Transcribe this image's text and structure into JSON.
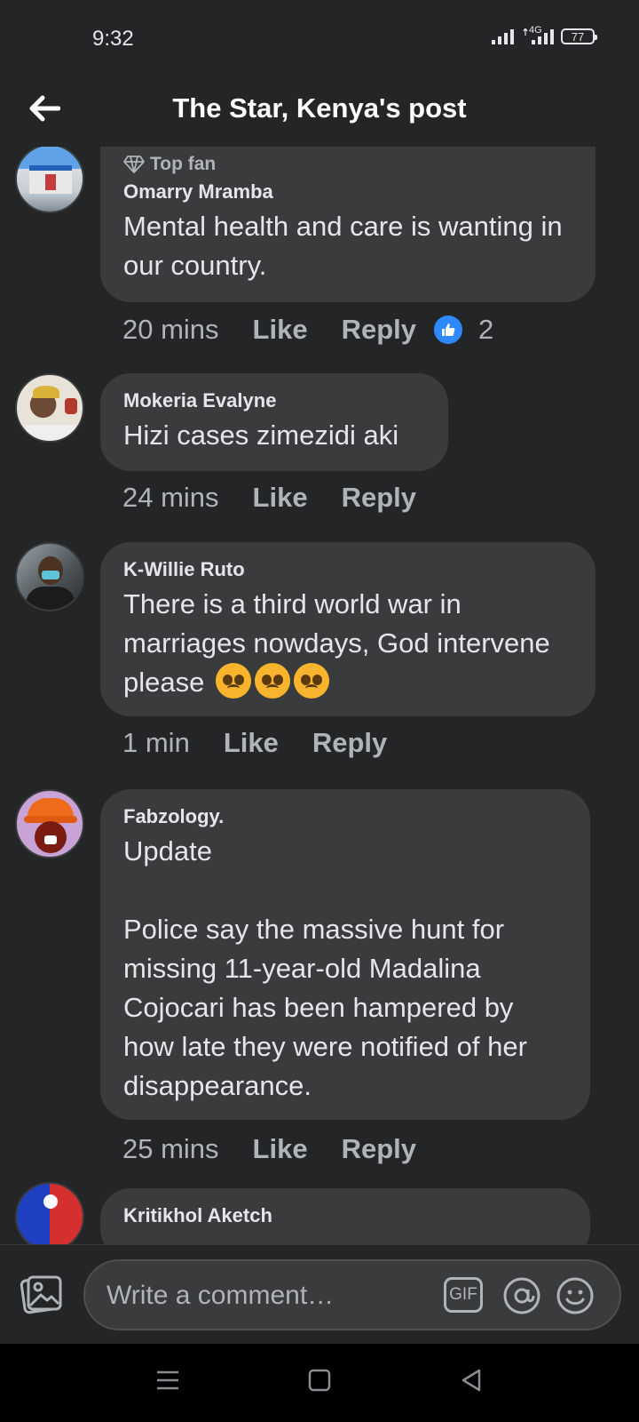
{
  "status": {
    "time": "9:32",
    "network": "4G",
    "battery": "77"
  },
  "header": {
    "title": "The Star, Kenya's post"
  },
  "comments": [
    {
      "badge": "Top fan",
      "author": "Omarry Mramba",
      "text": "Mental health and care is wanting in our country.",
      "time": "20 mins",
      "like": "Like",
      "reply": "Reply",
      "reactions": "2"
    },
    {
      "author": "Mokeria Evalyne",
      "text": "Hizi cases zimezidi aki",
      "time": "24 mins",
      "like": "Like",
      "reply": "Reply"
    },
    {
      "author": "K-Willie Ruto",
      "text": "There is a third world war in marriages nowdays, God intervene please",
      "time": "1 min",
      "like": "Like",
      "reply": "Reply"
    },
    {
      "author": "Fabzology.",
      "text": "Update\n\nPolice say the massive hunt for missing 11-year-old Madalina Cojocari has been hampered by how late they were notified of her disappearance.",
      "time": "25 mins",
      "like": "Like",
      "reply": "Reply"
    },
    {
      "author": "Kritikhol Aketch"
    }
  ],
  "composer": {
    "placeholder": "Write a comment…",
    "gif": "GIF"
  },
  "colors": {
    "background": "#242526",
    "bubble": "#3a3b3c",
    "like_blue": "#2e89ff"
  }
}
